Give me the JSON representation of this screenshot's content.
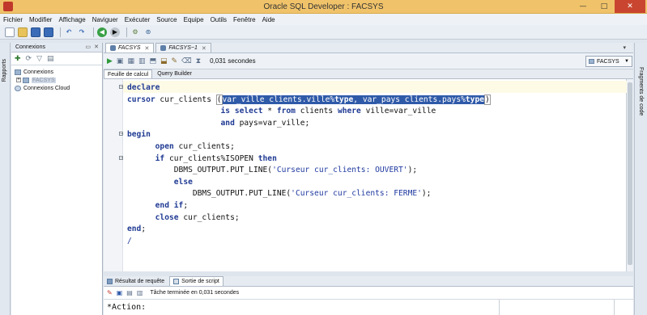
{
  "window": {
    "title": "Oracle SQL Developer : FACSYS",
    "minimize": "—",
    "maximize": "□",
    "close": "✕"
  },
  "menu": [
    "Fichier",
    "Modifier",
    "Affichage",
    "Naviguer",
    "Exécuter",
    "Source",
    "Equipe",
    "Outils",
    "Fenêtre",
    "Aide"
  ],
  "left_tab": {
    "label": "Rapports"
  },
  "connections_panel": {
    "title": "Connexions",
    "items": [
      {
        "label": "Connexions",
        "expander": ""
      },
      {
        "label": "FACSYS",
        "expander": "+"
      },
      {
        "label": "Connexions Cloud",
        "expander": ""
      }
    ]
  },
  "doc_tabs": [
    {
      "label": "FACSYS",
      "active": true
    },
    {
      "label": "FACSYS~1",
      "active": false
    }
  ],
  "editor_toolbar": {
    "timing": "0,031 secondes",
    "connection": "FACSYS"
  },
  "sub_tabs": [
    "Feuille de calcul",
    "Query Builder"
  ],
  "code_lines": [
    [
      {
        "t": "declare",
        "c": "kw"
      }
    ],
    [
      {
        "t": "cursor",
        "c": "kw"
      },
      {
        "t": " cur_clients ",
        "c": ""
      },
      {
        "t": "(",
        "c": "paren"
      },
      {
        "t": "var_ville clients.ville%",
        "c": "hl"
      },
      {
        "t": "type",
        "c": "hl kw2"
      },
      {
        "t": ", var_pays clients.pays%",
        "c": "hl"
      },
      {
        "t": "type",
        "c": "hl kw2"
      },
      {
        "t": ")",
        "c": "paren"
      }
    ],
    [
      {
        "t": "                    ",
        "c": ""
      },
      {
        "t": "is select",
        "c": "kw"
      },
      {
        "t": " * ",
        "c": ""
      },
      {
        "t": "from",
        "c": "kw"
      },
      {
        "t": " clients ",
        "c": ""
      },
      {
        "t": "where",
        "c": "kw"
      },
      {
        "t": " ville=var_ville",
        "c": ""
      }
    ],
    [
      {
        "t": "                    ",
        "c": ""
      },
      {
        "t": "and",
        "c": "kw"
      },
      {
        "t": " pays=var_ville;",
        "c": ""
      }
    ],
    [
      {
        "t": "begin",
        "c": "kw"
      }
    ],
    [
      {
        "t": "      ",
        "c": ""
      },
      {
        "t": "open",
        "c": "kw"
      },
      {
        "t": " cur_clients;",
        "c": ""
      }
    ],
    [
      {
        "t": "      ",
        "c": ""
      },
      {
        "t": "if",
        "c": "kw"
      },
      {
        "t": " cur_clients%ISOPEN ",
        "c": ""
      },
      {
        "t": "then",
        "c": "kw"
      }
    ],
    [
      {
        "t": "          DBMS_OUTPUT.PUT_LINE(",
        "c": ""
      },
      {
        "t": "'Curseur cur_clients: OUVERT'",
        "c": "str"
      },
      {
        "t": ");",
        "c": ""
      }
    ],
    [
      {
        "t": "          ",
        "c": ""
      },
      {
        "t": "else",
        "c": "kw"
      }
    ],
    [
      {
        "t": "              DBMS_OUTPUT.PUT_LINE(",
        "c": ""
      },
      {
        "t": "'Curseur cur_clients: FERME'",
        "c": "str"
      },
      {
        "t": ");",
        "c": ""
      }
    ],
    [
      {
        "t": "      ",
        "c": ""
      },
      {
        "t": "end if",
        "c": "kw"
      },
      {
        "t": ";",
        "c": ""
      }
    ],
    [
      {
        "t": "      ",
        "c": ""
      },
      {
        "t": "close",
        "c": "kw"
      },
      {
        "t": " cur_clients;",
        "c": ""
      }
    ],
    [
      {
        "t": "end",
        "c": "kw"
      },
      {
        "t": ";",
        "c": ""
      }
    ],
    [
      {
        "t": "/",
        "c": "str"
      }
    ]
  ],
  "bottom_tabs": [
    "Résultat de requête",
    "Sortie de script"
  ],
  "bottom_status": "Tâche terminée en 0,031 secondes",
  "output_text": "*Action:",
  "right_tab": {
    "label": "Fragments de code"
  }
}
